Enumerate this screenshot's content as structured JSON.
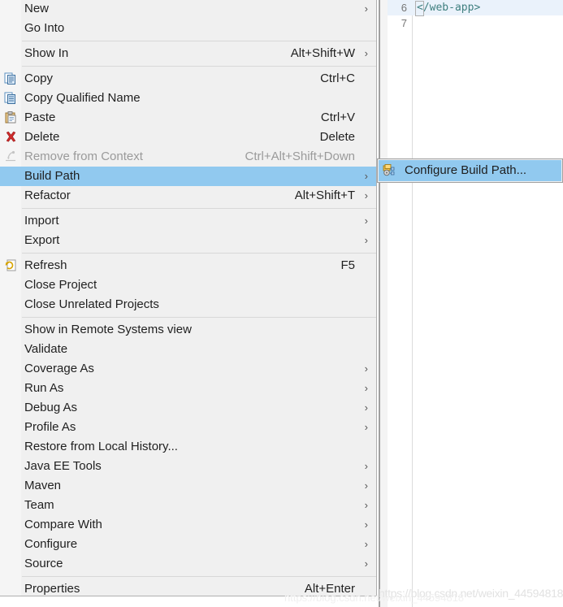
{
  "editor": {
    "lines": [
      {
        "number": "6",
        "code": "</web-app>",
        "current": true
      },
      {
        "number": "7",
        "code": "",
        "current": false
      }
    ]
  },
  "context_menu": {
    "groups": [
      {
        "items": [
          {
            "label": "New",
            "accel": "",
            "arrow": true,
            "icon": "",
            "disabled": false,
            "selected": false
          },
          {
            "label": "Go Into",
            "accel": "",
            "arrow": false,
            "icon": "",
            "disabled": false,
            "selected": false
          }
        ]
      },
      {
        "items": [
          {
            "label": "Show In",
            "accel": "Alt+Shift+W",
            "arrow": true,
            "icon": "",
            "disabled": false,
            "selected": false
          }
        ]
      },
      {
        "items": [
          {
            "label": "Copy",
            "accel": "Ctrl+C",
            "arrow": false,
            "icon": "copy-icon",
            "disabled": false,
            "selected": false
          },
          {
            "label": "Copy Qualified Name",
            "accel": "",
            "arrow": false,
            "icon": "copy-qualified-name-icon",
            "disabled": false,
            "selected": false
          },
          {
            "label": "Paste",
            "accel": "Ctrl+V",
            "arrow": false,
            "icon": "paste-icon",
            "disabled": false,
            "selected": false
          },
          {
            "label": "Delete",
            "accel": "Delete",
            "arrow": false,
            "icon": "delete-icon",
            "disabled": false,
            "selected": false
          },
          {
            "label": "Remove from Context",
            "accel": "Ctrl+Alt+Shift+Down",
            "arrow": false,
            "icon": "remove-from-context-icon",
            "disabled": true,
            "selected": false
          },
          {
            "label": "Build Path",
            "accel": "",
            "arrow": true,
            "icon": "",
            "disabled": false,
            "selected": true
          },
          {
            "label": "Refactor",
            "accel": "Alt+Shift+T",
            "arrow": true,
            "icon": "",
            "disabled": false,
            "selected": false
          }
        ]
      },
      {
        "items": [
          {
            "label": "Import",
            "accel": "",
            "arrow": true,
            "icon": "",
            "disabled": false,
            "selected": false
          },
          {
            "label": "Export",
            "accel": "",
            "arrow": true,
            "icon": "",
            "disabled": false,
            "selected": false
          }
        ]
      },
      {
        "items": [
          {
            "label": "Refresh",
            "accel": "F5",
            "arrow": false,
            "icon": "refresh-icon",
            "disabled": false,
            "selected": false
          },
          {
            "label": "Close Project",
            "accel": "",
            "arrow": false,
            "icon": "",
            "disabled": false,
            "selected": false
          },
          {
            "label": "Close Unrelated Projects",
            "accel": "",
            "arrow": false,
            "icon": "",
            "disabled": false,
            "selected": false
          }
        ]
      },
      {
        "items": [
          {
            "label": "Show in Remote Systems view",
            "accel": "",
            "arrow": false,
            "icon": "",
            "disabled": false,
            "selected": false
          },
          {
            "label": "Validate",
            "accel": "",
            "arrow": false,
            "icon": "",
            "disabled": false,
            "selected": false
          },
          {
            "label": "Coverage As",
            "accel": "",
            "arrow": true,
            "icon": "",
            "disabled": false,
            "selected": false
          },
          {
            "label": "Run As",
            "accel": "",
            "arrow": true,
            "icon": "",
            "disabled": false,
            "selected": false
          },
          {
            "label": "Debug As",
            "accel": "",
            "arrow": true,
            "icon": "",
            "disabled": false,
            "selected": false
          },
          {
            "label": "Profile As",
            "accel": "",
            "arrow": true,
            "icon": "",
            "disabled": false,
            "selected": false
          },
          {
            "label": "Restore from Local History...",
            "accel": "",
            "arrow": false,
            "icon": "",
            "disabled": false,
            "selected": false
          },
          {
            "label": "Java EE Tools",
            "accel": "",
            "arrow": true,
            "icon": "",
            "disabled": false,
            "selected": false
          },
          {
            "label": "Maven",
            "accel": "",
            "arrow": true,
            "icon": "",
            "disabled": false,
            "selected": false
          },
          {
            "label": "Team",
            "accel": "",
            "arrow": true,
            "icon": "",
            "disabled": false,
            "selected": false
          },
          {
            "label": "Compare With",
            "accel": "",
            "arrow": true,
            "icon": "",
            "disabled": false,
            "selected": false
          },
          {
            "label": "Configure",
            "accel": "",
            "arrow": true,
            "icon": "",
            "disabled": false,
            "selected": false
          },
          {
            "label": "Source",
            "accel": "",
            "arrow": true,
            "icon": "",
            "disabled": false,
            "selected": false
          }
        ]
      },
      {
        "items": [
          {
            "label": "Properties",
            "accel": "Alt+Enter",
            "arrow": false,
            "icon": "",
            "disabled": false,
            "selected": false
          }
        ]
      }
    ]
  },
  "submenu": {
    "items": [
      {
        "label": "Configure Build Path...",
        "accel": "",
        "arrow": false,
        "icon": "configure-build-path-icon",
        "disabled": false,
        "selected": true
      }
    ]
  },
  "watermark": {
    "text": "https://blog.csdn.net/weixin_44594818"
  },
  "colors": {
    "menu_background": "#f0f0f0",
    "menu_gutter": "#f5f5f5",
    "highlight": "#91c9ef",
    "separator": "#d8d8d8",
    "text": "#1f1f1f",
    "text_disabled": "#9a9a9a",
    "current_line": "#eaf2fb",
    "xml_tag": "#3f7f7f",
    "scrollbar_thumb": "#1e78c8"
  },
  "arrow_glyph": "›"
}
